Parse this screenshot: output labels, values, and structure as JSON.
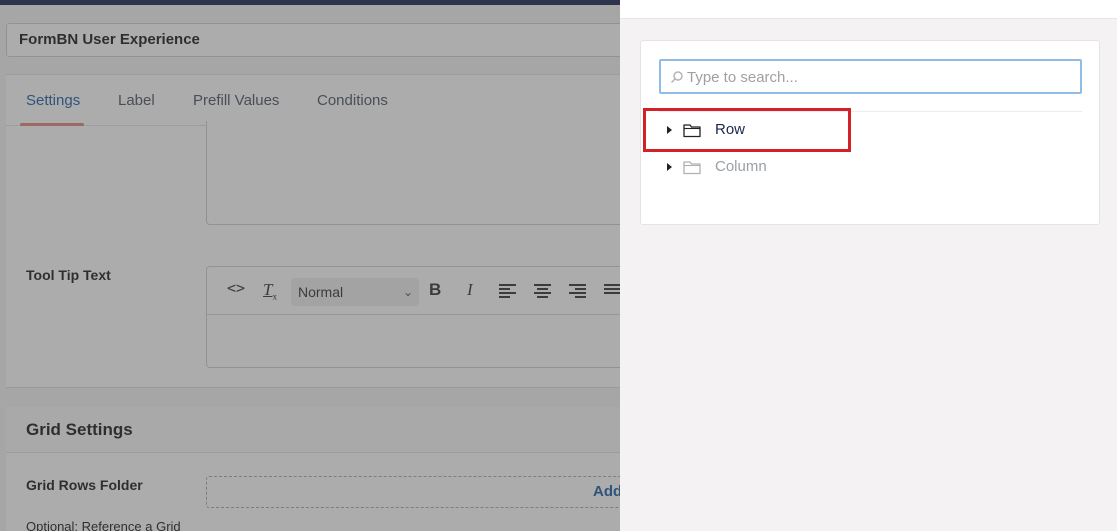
{
  "form": {
    "title": "FormBN User Experience",
    "tabs": [
      {
        "label": "Settings",
        "active": true
      },
      {
        "label": "Label",
        "active": false
      },
      {
        "label": "Prefill Values",
        "active": false
      },
      {
        "label": "Conditions",
        "active": false
      }
    ],
    "tooltip_label": "Tool Tip Text",
    "rte": {
      "format_value": "Normal",
      "bold": "B",
      "italic": "I"
    },
    "grid_settings_title": "Grid Settings",
    "grid_rows_label": "Grid Rows Folder",
    "add_label": "Add",
    "optional_text": "Optional: Reference a Grid"
  },
  "drawer": {
    "search_placeholder": "Type to search...",
    "tree": [
      {
        "label": "Row",
        "enabled": true,
        "highlighted": true,
        "icon": "folder-icon"
      },
      {
        "label": "Column",
        "enabled": false,
        "highlighted": false,
        "icon": "folder-icon"
      }
    ]
  },
  "colors": {
    "accent": "#1d5fa7",
    "tab_underline": "#e2867e",
    "highlight": "#d32128",
    "search_focus": "#8fbde6",
    "topbar": "#1b264f"
  }
}
